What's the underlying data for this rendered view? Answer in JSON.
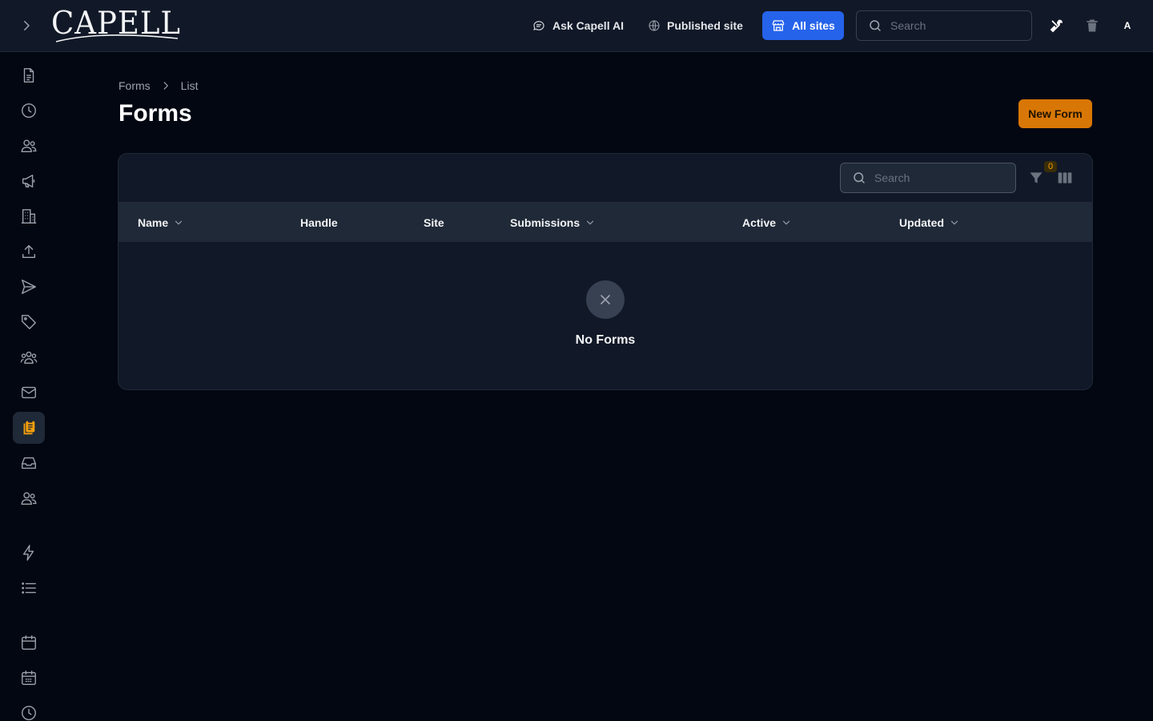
{
  "app": {
    "logo_text": "CAPELL"
  },
  "topbar": {
    "ask_ai": "Ask Capell AI",
    "published_site": "Published site",
    "all_sites": "All sites",
    "search_placeholder": "Search",
    "avatar_initial": "A"
  },
  "sidebar": {
    "items": [
      {
        "icon": "document-icon"
      },
      {
        "icon": "clock-icon"
      },
      {
        "icon": "users-icon"
      },
      {
        "icon": "megaphone-icon"
      },
      {
        "icon": "building-icon"
      },
      {
        "icon": "upload-icon"
      },
      {
        "icon": "send-icon"
      },
      {
        "icon": "tag-icon"
      },
      {
        "icon": "user-group-icon"
      },
      {
        "icon": "envelope-icon"
      },
      {
        "icon": "clipboard-forms-icon",
        "active": true
      },
      {
        "icon": "inbox-icon"
      },
      {
        "icon": "users-icon"
      },
      {
        "icon": "bolt-icon"
      },
      {
        "icon": "list-icon"
      },
      {
        "icon": "calendar-icon"
      },
      {
        "icon": "calendar-days-icon"
      },
      {
        "icon": "clock-icon"
      }
    ]
  },
  "breadcrumb": {
    "items": [
      "Forms",
      "List"
    ]
  },
  "page": {
    "title": "Forms",
    "new_button": "New Form"
  },
  "table": {
    "search_placeholder": "Search",
    "filter_count": "0",
    "columns": [
      {
        "label": "Name",
        "sortable": true
      },
      {
        "label": "Handle",
        "sortable": false
      },
      {
        "label": "Site",
        "sortable": false
      },
      {
        "label": "Submissions",
        "sortable": true
      },
      {
        "label": "Active",
        "sortable": true
      },
      {
        "label": "Updated",
        "sortable": true
      }
    ],
    "empty_text": "No Forms"
  },
  "colors": {
    "accent": "#2563eb",
    "primary_action": "#d97706",
    "active_icon": "#f59e0b",
    "background": "#030712",
    "surface": "#111827"
  }
}
